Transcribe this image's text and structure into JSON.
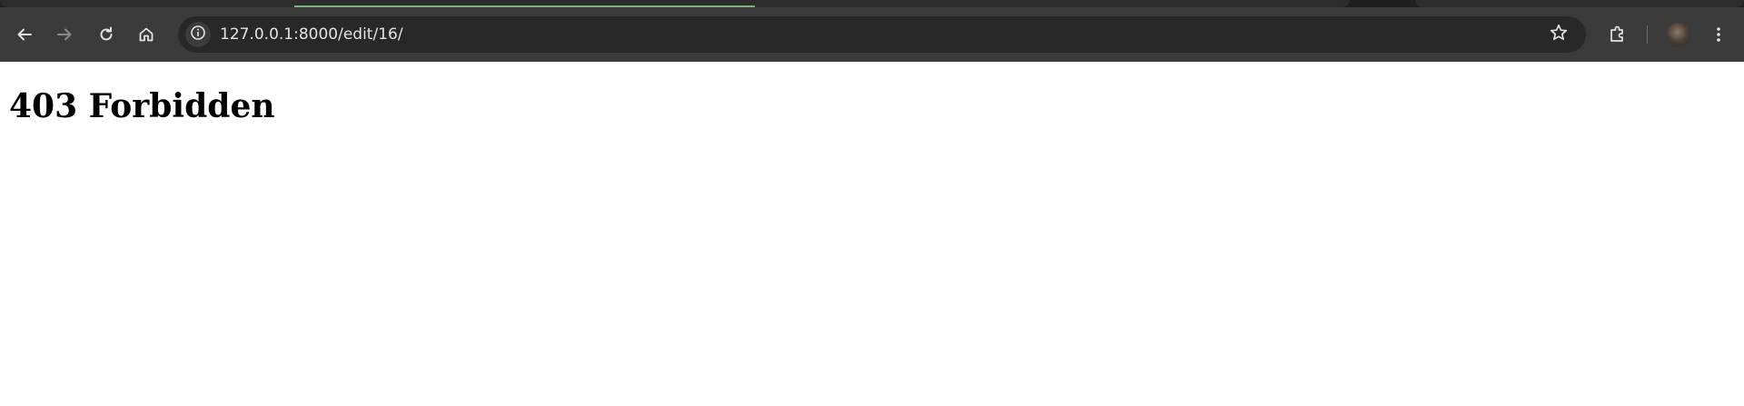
{
  "browser": {
    "address_bar": {
      "url": "127.0.0.1:8000/edit/16/"
    },
    "toolbar": {
      "back": "arrow-left-icon",
      "forward": "arrow-right-icon",
      "reload": "reload-icon",
      "home": "home-icon",
      "site_info": "info-icon",
      "bookmark": "star-icon",
      "extensions": "puzzle-icon",
      "profile": "avatar",
      "menu": "kebab-menu-icon"
    },
    "page_loading": true
  },
  "page": {
    "heading": "403 Forbidden"
  },
  "colors": {
    "toolbar_bg": "#3b3b3b",
    "omnibox_bg": "#282828",
    "progress": "#6fbf73",
    "page_bg": "#ffffff"
  }
}
